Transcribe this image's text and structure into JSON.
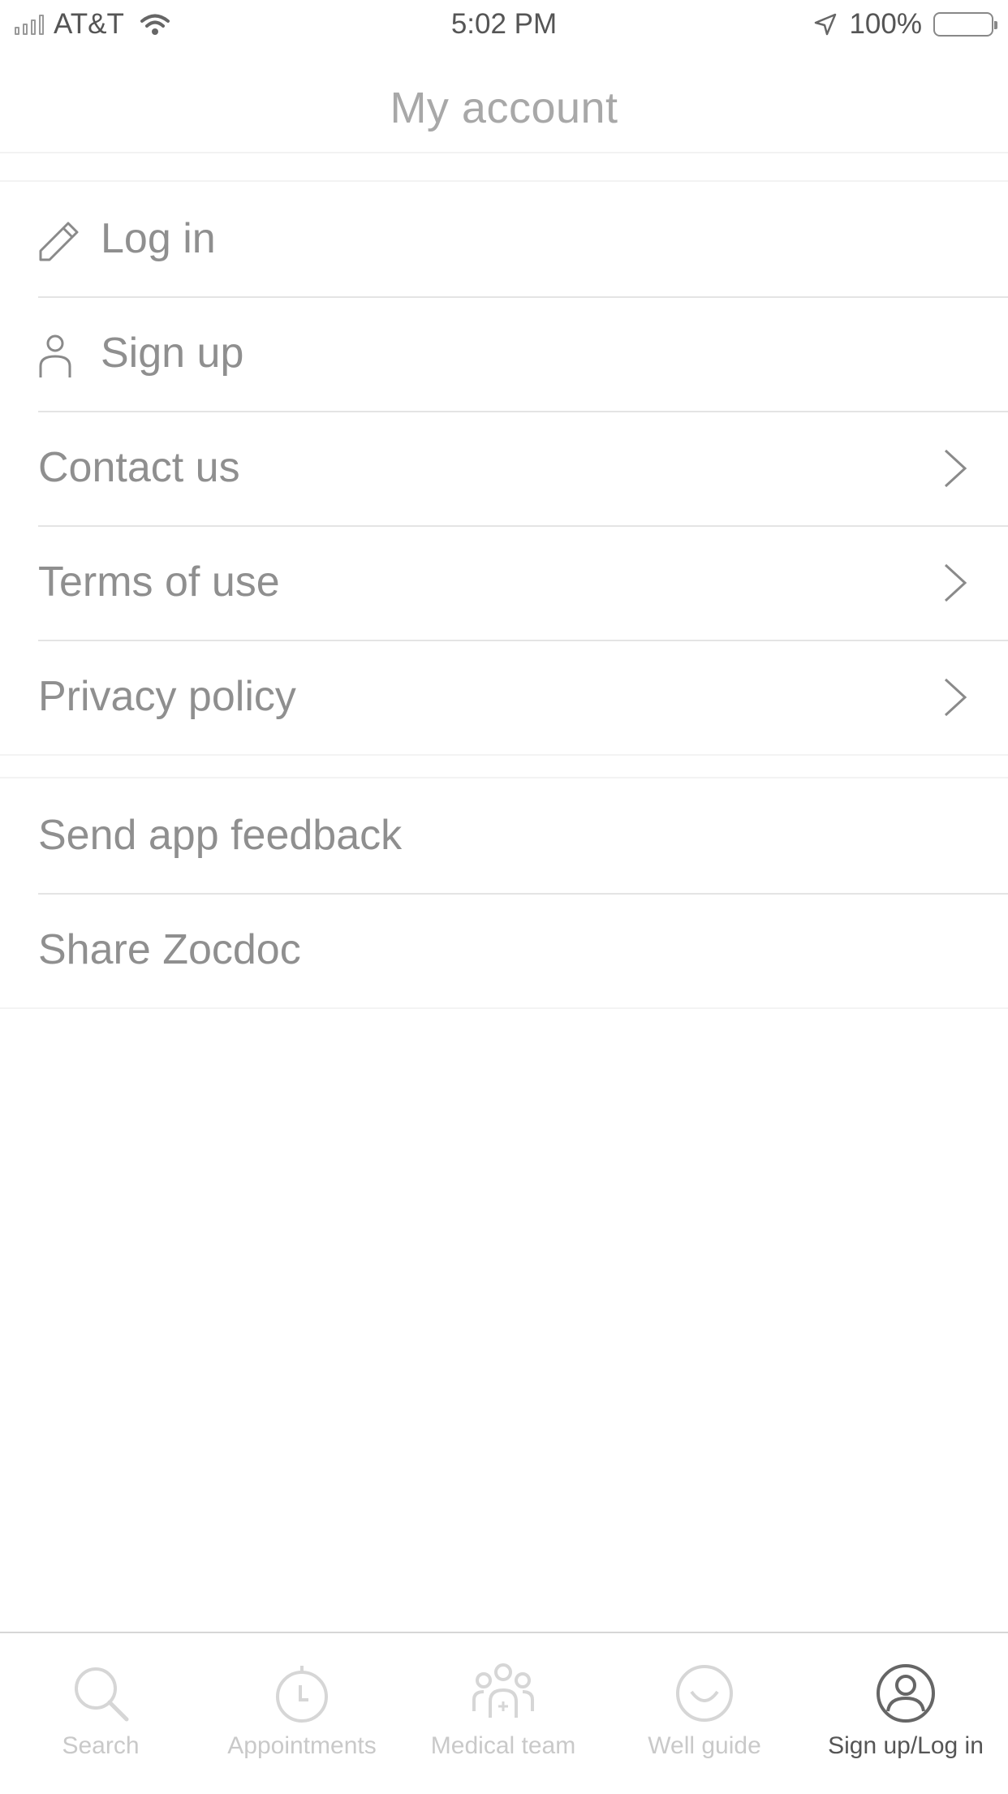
{
  "status_bar": {
    "carrier": "AT&T",
    "time": "5:02 PM",
    "battery": "100%"
  },
  "nav": {
    "title": "My account"
  },
  "account_menu": [
    {
      "label": "Log in",
      "icon": "pencil-icon"
    },
    {
      "label": "Sign up",
      "icon": "person-icon"
    },
    {
      "label": "Contact us",
      "icon": "chevron-right-icon"
    },
    {
      "label": "Terms of use",
      "icon": "chevron-right-icon"
    },
    {
      "label": "Privacy policy",
      "icon": "chevron-right-icon"
    }
  ],
  "more_menu": [
    {
      "label": "Send app feedback"
    },
    {
      "label": "Share Zocdoc"
    }
  ],
  "tab_bar": [
    {
      "label": "Search",
      "icon": "search-icon",
      "active": false
    },
    {
      "label": "Appointments",
      "icon": "clock-icon",
      "active": false
    },
    {
      "label": "Medical team",
      "icon": "team-icon",
      "active": false
    },
    {
      "label": "Well guide",
      "icon": "smile-icon",
      "active": false
    },
    {
      "label": "Sign up/Log in",
      "icon": "profile-icon",
      "active": true
    }
  ],
  "colors": {
    "background": "#ffffff",
    "text": "#8f8f8f",
    "divider": "#e4e4e4",
    "tab_inactive": "#c9c9c9",
    "tab_active": "#555555"
  }
}
